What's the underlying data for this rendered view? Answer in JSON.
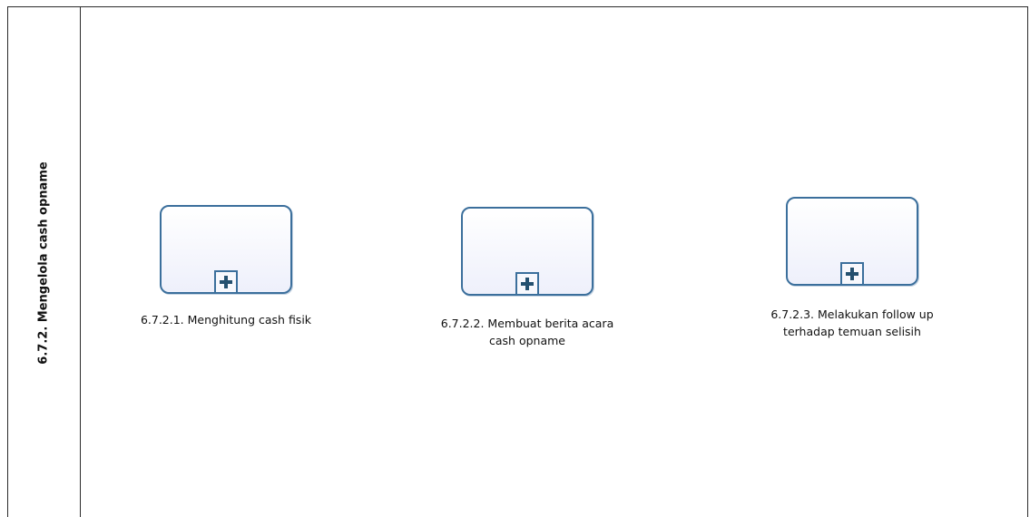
{
  "lane": {
    "title": "6.7.2. Mengelola cash opname"
  },
  "tasks": [
    {
      "label": "6.7.2.1. Menghitung cash fisik"
    },
    {
      "label": "6.7.2.2. Membuat berita acara\ncash opname"
    },
    {
      "label": "6.7.2.3. Melakukan follow up\nterhadap temuan selisih"
    }
  ],
  "colors": {
    "task_border": "#3b6f9c",
    "task_fill_top": "#ffffff",
    "task_fill_bottom": "#eef0fb",
    "marker_plus": "#24506f",
    "lines": "#2b2b2b"
  },
  "icons": {
    "subprocess_marker": "plus-square-icon"
  }
}
